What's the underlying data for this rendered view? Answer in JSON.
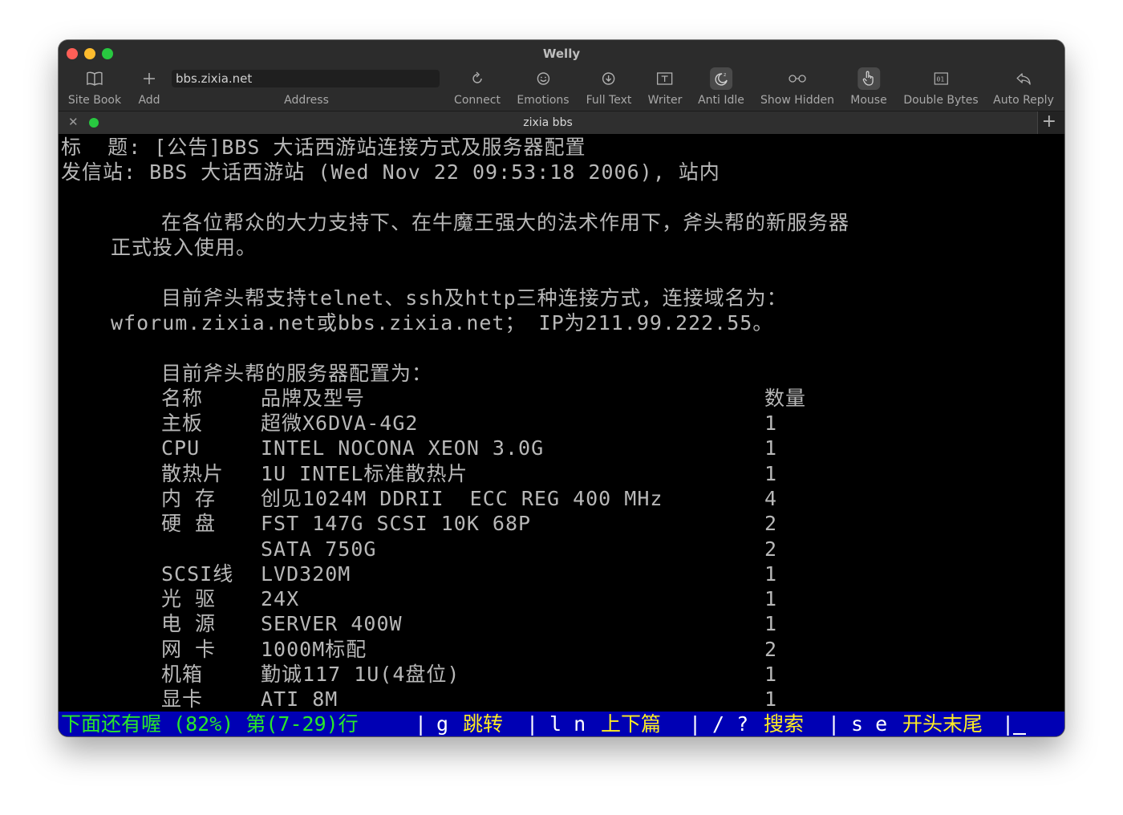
{
  "window": {
    "title": "Welly"
  },
  "toolbar": {
    "site_book": "Site Book",
    "add": "Add",
    "address_value": "bbs.zixia.net",
    "address_label": "Address",
    "connect": "Connect",
    "emotions": "Emotions",
    "full_text": "Full Text",
    "writer": "Writer",
    "anti_idle": "Anti Idle",
    "show_hidden": "Show Hidden",
    "mouse": "Mouse",
    "double_bytes": "Double Bytes",
    "auto_reply": "Auto Reply"
  },
  "tab": {
    "title": "zixia bbs"
  },
  "post": {
    "subject": "标  题: [公告]BBS 大话西游站连接方式及服务器配置",
    "sender": "发信站: BBS 大话西游站 (Wed Nov 22 09:53:18 2006), 站内",
    "para1_line1": "在各位帮众的大力支持下、在牛魔王强大的法术作用下，斧头帮的新服务器",
    "para1_line2": "正式投入使用。",
    "para2_line1": "目前斧头帮支持telnet、ssh及http三种连接方式，连接域名为：",
    "para2_line2": "wforum.zixia.net或bbs.zixia.net； IP为211.99.222.55。",
    "config_heading": "目前斧头帮的服务器配置为：",
    "table_header": {
      "name": "名称",
      "brand": "品牌及型号",
      "qty": "数量"
    },
    "rows": [
      {
        "name": "主板",
        "brand": "超微X6DVA-4G2",
        "qty": "1"
      },
      {
        "name": "CPU",
        "brand": "INTEL NOCONA XEON 3.0G",
        "qty": "1"
      },
      {
        "name": "散热片",
        "brand": "1U INTEL标准散热片",
        "qty": "1"
      },
      {
        "name": "内 存",
        "brand": "创见1024M DDRII  ECC REG 400 MHz",
        "qty": "4"
      },
      {
        "name": "硬 盘",
        "brand": "FST 147G SCSI 10K 68P",
        "qty": "2"
      },
      {
        "name": "",
        "brand": "SATA 750G",
        "qty": "2"
      },
      {
        "name": "SCSI线",
        "brand": "LVD320M",
        "qty": "1"
      },
      {
        "name": "光 驱",
        "brand": "24X",
        "qty": "1"
      },
      {
        "name": "电 源",
        "brand": "SERVER 400W",
        "qty": "1"
      },
      {
        "name": "网 卡",
        "brand": "1000M标配",
        "qty": "2"
      },
      {
        "name": "机箱",
        "brand": "勤诚117 1U(4盘位)",
        "qty": "1"
      },
      {
        "name": "显卡",
        "brand": "ATI 8M",
        "qty": "1"
      }
    ]
  },
  "statusbar": {
    "progress": "下面还有喔 (82%) 第(7-29)行",
    "sep1": "|",
    "g_key": "g",
    "g_label": "跳转",
    "sep2": "|",
    "ln_keys": "l n",
    "ln_label": "上下篇",
    "sep3": "|",
    "search_keys": "/ ?",
    "search_label": "搜索",
    "sep4": "|",
    "se_keys": "s e",
    "se_label": "开头末尾",
    "sep5": "|"
  },
  "colors": {
    "traffic_red": "#ff5f57",
    "traffic_yellow": "#febc2e",
    "traffic_green": "#28c840",
    "status_bg": "#0000b4",
    "status_green": "#29e829",
    "status_yellow": "#ffee22"
  },
  "icons": [
    "book-icon",
    "plus-icon",
    "reload-icon",
    "smiley-icon",
    "download-circle-icon",
    "text-box-icon",
    "moon-icon",
    "glasses-icon",
    "hand-pointer-icon",
    "bytes-icon",
    "reply-icon"
  ]
}
